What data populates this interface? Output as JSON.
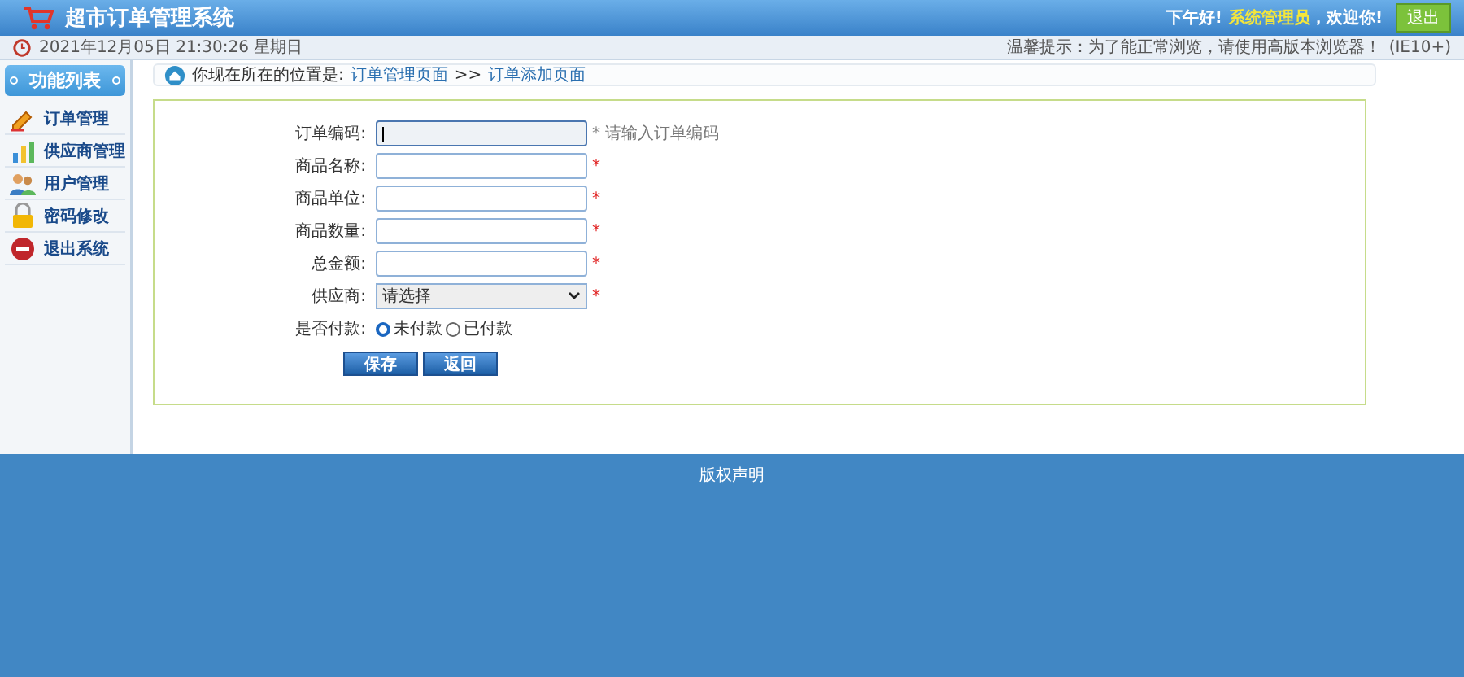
{
  "header": {
    "title": "超市订单管理系统",
    "greeting": "下午好!",
    "user": "系统管理员",
    "welcome": "，欢迎你!",
    "logout": "退出"
  },
  "subbar": {
    "datetime": "2021年12月05日 21:30:26 星期日",
    "tip": "温馨提示：为了能正常浏览，请使用高版本浏览器！",
    "browser": "(IE10+)"
  },
  "sidebar": {
    "title": "功能列表",
    "items": [
      {
        "label": "订单管理",
        "kind": "pencil"
      },
      {
        "label": "供应商管理",
        "kind": "chart"
      },
      {
        "label": "用户管理",
        "kind": "people"
      },
      {
        "label": "密码修改",
        "kind": "lock"
      },
      {
        "label": "退出系统",
        "kind": "stop"
      }
    ]
  },
  "breadcrumb": {
    "prefix": "你现在所在的位置是:",
    "path": "订单管理页面",
    "separator": ">>",
    "current": "订单添加页面"
  },
  "form": {
    "fields": [
      {
        "label": "订单编码:",
        "kind": "text",
        "mark": "*",
        "hint": "请输入订单编码",
        "focused": true
      },
      {
        "label": "商品名称:",
        "kind": "text",
        "mark": "*",
        "focused": false
      },
      {
        "label": "商品单位:",
        "kind": "text",
        "mark": "*",
        "focused": false
      },
      {
        "label": "商品数量:",
        "kind": "text",
        "mark": "*",
        "focused": false
      },
      {
        "label": "总金额:",
        "kind": "text",
        "mark": "*",
        "focused": false
      },
      {
        "label": "供应商:",
        "kind": "select",
        "value": "请选择",
        "mark": "*"
      },
      {
        "label": "是否付款:",
        "kind": "radio",
        "options": [
          {
            "label": "未付款",
            "selected": true
          },
          {
            "label": "已付款",
            "selected": false
          }
        ]
      }
    ],
    "buttons": [
      "保存",
      "返回"
    ]
  },
  "footer": {
    "text": "版权声明"
  }
}
